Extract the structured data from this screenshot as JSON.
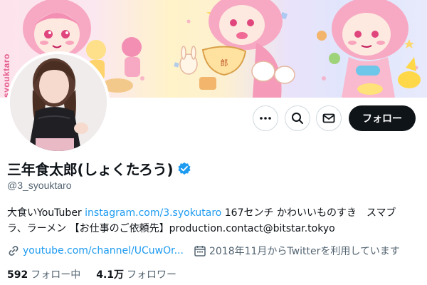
{
  "banner": {
    "side_text": "syouktaro"
  },
  "actions": {
    "follow_label": "フォロー"
  },
  "profile": {
    "display_name": "三年食太郎(しょくたろう)",
    "handle": "@3_syouktaro"
  },
  "bio": {
    "line1_prefix": "大食いYouTuber ",
    "line1_link": "instagram.com/3.syokutaro",
    "line1_suffix": " 167センチ かわいいものすき　スマブ",
    "line2": "ラ、ラーメン 【お仕事のご依頼先】production.contact@bitstar.tokyo"
  },
  "meta": {
    "website": "youtube.com/channel/UCuwOr...",
    "joined": "2018年11月からTwitterを利用しています"
  },
  "stats": {
    "following_count": "592",
    "following_label": "フォロー中",
    "followers_count": "4.1万",
    "followers_label": "フォロワー"
  },
  "icons": {
    "more": "more-icon",
    "search": "search-icon",
    "mail": "mail-icon",
    "verified": "verified-badge-icon",
    "link": "link-icon",
    "calendar": "calendar-icon"
  },
  "colors": {
    "accent_link": "#1d9bf0",
    "follow_button": "#0f1419",
    "secondary_text": "#536471"
  }
}
